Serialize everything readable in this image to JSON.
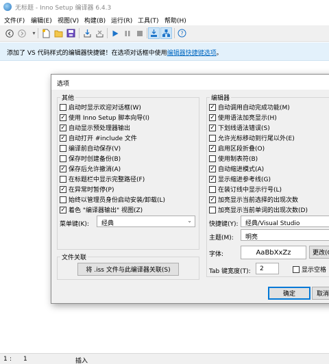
{
  "window": {
    "title": "无标题 - Inno Setup 编译器 6.4.3"
  },
  "menu": [
    "文件(F)",
    "编辑(E)",
    "视图(V)",
    "构建(B)",
    "运行(R)",
    "工具(T)",
    "帮助(H)"
  ],
  "toolbar": {
    "icons": [
      "history-back-icon",
      "history-forward-icon",
      "new-file-icon",
      "open-file-icon",
      "save-file-icon",
      "compile-icon",
      "stop-compile-icon",
      "run-icon",
      "pause-icon",
      "terminate-icon",
      "toggle-breakpoint-icon",
      "debug-step-icon",
      "show-options-icon",
      "help-icon"
    ]
  },
  "notification": {
    "text": "添加了 VS 代码样式的编辑器快捷键！在选项对话框中使用",
    "link": "编辑器快捷键选项",
    "suffix": "。"
  },
  "status": {
    "line": "1",
    "col": "1",
    "mode": "插入"
  },
  "dialog": {
    "title": "选项",
    "misc": {
      "label": "其他",
      "options": [
        {
          "label": "启动时显示欢迎对话框(W)",
          "checked": false
        },
        {
          "label": "使用 Inno Setup 脚本向导(I)",
          "checked": true
        },
        {
          "label": "自动显示预处理器输出",
          "checked": true
        },
        {
          "label": "自动打开 #include 文件",
          "checked": true
        },
        {
          "label": "编译前自动保存(V)",
          "checked": false
        },
        {
          "label": "保存时创建备份(B)",
          "checked": false
        },
        {
          "label": "保存后允许撤消(A)",
          "checked": true
        },
        {
          "label": "在标题栏中显示完整路径(F)",
          "checked": false
        },
        {
          "label": "在异常时暂停(P)",
          "checked": true
        },
        {
          "label": "始终以管理员身份启动安装/卸载(L)",
          "checked": false
        },
        {
          "label": "着色 \"编译器输出\" 视图(Z)",
          "checked": true
        }
      ],
      "menu_keys_label": "菜单键(K):",
      "menu_keys_value": "经典"
    },
    "assoc": {
      "label": "文件关联",
      "button": "将 .iss 文件与此编译器关联(S)"
    },
    "editor": {
      "label": "编辑器",
      "options": [
        {
          "label": "自动调用自动完成功能(M)",
          "checked": true
        },
        {
          "label": "使用语法加亮显示(H)",
          "checked": true
        },
        {
          "label": "下划线语法错误(S)",
          "checked": true
        },
        {
          "label": "允许光标移动到行尾以外(E)",
          "checked": false
        },
        {
          "label": "启用区段折叠(O)",
          "checked": true
        },
        {
          "label": "使用制表符(B)",
          "checked": false
        },
        {
          "label": "自动缩进模式(A)",
          "checked": true
        },
        {
          "label": "显示缩进参考线(G)",
          "checked": true
        },
        {
          "label": "在装订线中显示行号(L)",
          "checked": false
        },
        {
          "label": "加亮显示当前选择的出现次数",
          "checked": true
        },
        {
          "label": "加亮显示当前单词的出现次数(D)",
          "checked": false
        }
      ],
      "shortcut_label": "快捷键(Y):",
      "shortcut_value": "经典/Visual Studio",
      "theme_label": "主题(M):",
      "theme_value": "明亮",
      "font_label": "字体:",
      "font_preview": "AaBbXxZz",
      "font_button": "更改(C)",
      "tab_label": "Tab 键宽度(T):",
      "tab_value": "2",
      "show_spaces": {
        "label": "显示空格",
        "checked": false
      }
    },
    "ok": "确定",
    "cancel": "取消"
  }
}
